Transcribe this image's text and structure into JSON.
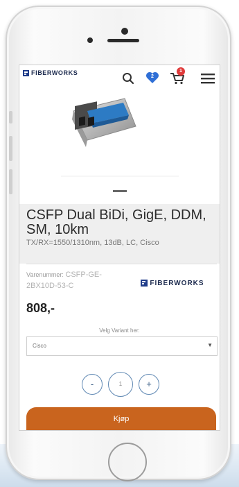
{
  "header": {
    "logo_text": "FIBERWORKS",
    "wishlist_count": "2",
    "cart_count": "1",
    "icons": [
      "search-icon",
      "heart-icon",
      "cart-icon",
      "hamburger-menu-icon"
    ]
  },
  "product": {
    "title": "CSFP Dual BiDi, GigE, DDM, SM, 10km",
    "subtitle": "TX/RX=1550/1310nm, 13dB, LC, Cisco",
    "sku_label": "Varenummer:",
    "sku_value": "CSFP-GE-2BX10D-53-C",
    "brand_logo_text": "FIBERWORKS",
    "price": "808,-"
  },
  "variant": {
    "label": "Velg Variant her:",
    "selected": "Cisco"
  },
  "quantity": {
    "minus_label": "-",
    "value": "1",
    "plus_label": "+"
  },
  "buy_label": "Kjøp",
  "colors": {
    "brand_blue": "#1f3c8a",
    "wishlist_blue": "#2f6fd6",
    "cart_badge_red": "#e03a3a",
    "buy_orange": "#c9641e",
    "qty_border": "#5f88b3"
  }
}
